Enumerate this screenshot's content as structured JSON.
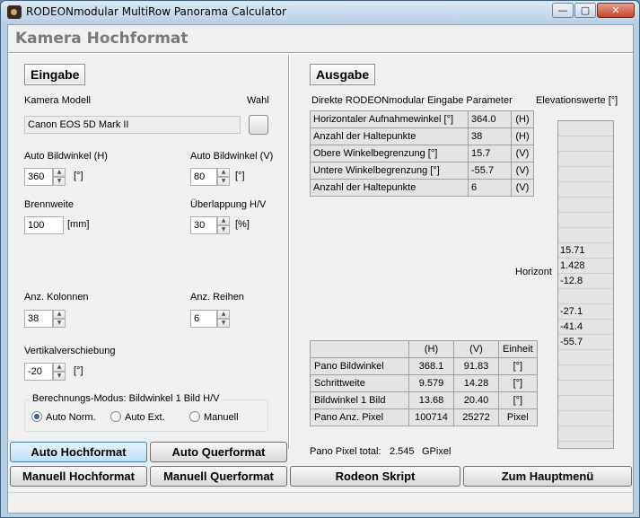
{
  "window": {
    "title": "RODEONmodular  MultiRow Panorama Calculator",
    "min_label": "—",
    "max_label": "▢",
    "close_label": "✕"
  },
  "page": {
    "heading": "Kamera Hochformat"
  },
  "input": {
    "section_label": "Eingabe",
    "camera_model_label": "Kamera Modell",
    "choose_label": "Wahl",
    "camera_model_value": "Canon EOS 5D Mark II",
    "angle_h_label": "Auto Bildwinkel (H)",
    "angle_h_value": "360",
    "angle_h_unit": "[°]",
    "angle_v_label": "Auto Bildwinkel (V)",
    "angle_v_value": "80",
    "angle_v_unit": "[°]",
    "focal_label": "Brennweite",
    "focal_value": "100",
    "focal_unit": "[mm]",
    "overlap_label": "Überlappung H/V",
    "overlap_value": "30",
    "overlap_unit": "[%]",
    "columns_label": "Anz. Kolonnen",
    "columns_value": "38",
    "rows_label": "Anz. Reihen",
    "rows_value": "6",
    "vshift_label": "Vertikalverschiebung",
    "vshift_value": "-20",
    "vshift_unit": "[°]",
    "mode_legend": "Berechnungs-Modus: Bildwinkel 1 Bild H/V",
    "mode_options": [
      "Auto Norm.",
      "Auto Ext.",
      "Manuell"
    ],
    "mode_selected": "Auto Norm."
  },
  "output": {
    "section_label": "Ausgabe",
    "params_title": "Direkte RODEONmodular Eingabe Parameter",
    "params": [
      {
        "label": "Horizontaler Aufnahmewinkel [°]",
        "value": "364.0",
        "unit": "(H)"
      },
      {
        "label": "Anzahl der Haltepunkte",
        "value": "38",
        "unit": "(H)"
      },
      {
        "label": "Obere Winkelbegrenzung [°]",
        "value": "15.7",
        "unit": "(V)"
      },
      {
        "label": "Untere Winkelbegrenzung [°]",
        "value": "-55.7",
        "unit": "(V)"
      },
      {
        "label": "Anzahl der Haltepunkte",
        "value": "6",
        "unit": "(V)"
      }
    ],
    "elevation_title": "Elevationswerte [°]",
    "horizon_label": "Horizont",
    "elevation_values": [
      "15.71",
      "1.428",
      "-12.8",
      "",
      "-27.1",
      "-41.4",
      "-55.7"
    ],
    "results_headers": [
      "",
      "(H)",
      "(V)",
      "Einheit"
    ],
    "results": [
      {
        "label": "Pano Bildwinkel",
        "h": "368.1",
        "v": "91.83",
        "unit": "[°]"
      },
      {
        "label": "Schrittweite",
        "h": "9.579",
        "v": "14.28",
        "unit": "[°]"
      },
      {
        "label": "Bildwinkel 1 Bild",
        "h": "13.68",
        "v": "20.40",
        "unit": "[°]"
      },
      {
        "label": "Pano Anz. Pixel",
        "h": "100714",
        "v": "25272",
        "unit": "Pixel"
      }
    ],
    "total_label": "Pano Pixel total:",
    "total_value": "2.545",
    "total_unit": "GPixel"
  },
  "buttons": {
    "auto_portrait": "Auto Hochformat",
    "auto_landscape": "Auto Querformat",
    "manual_portrait": "Manuell Hochformat",
    "manual_landscape": "Manuell Querformat",
    "rodeon_script": "Rodeon Skript",
    "main_menu": "Zum Hauptmenü"
  },
  "colors": {
    "accent": "#3c7fb1",
    "active_button": "#bfe0f7",
    "window_frame": "#b8cfe4"
  }
}
